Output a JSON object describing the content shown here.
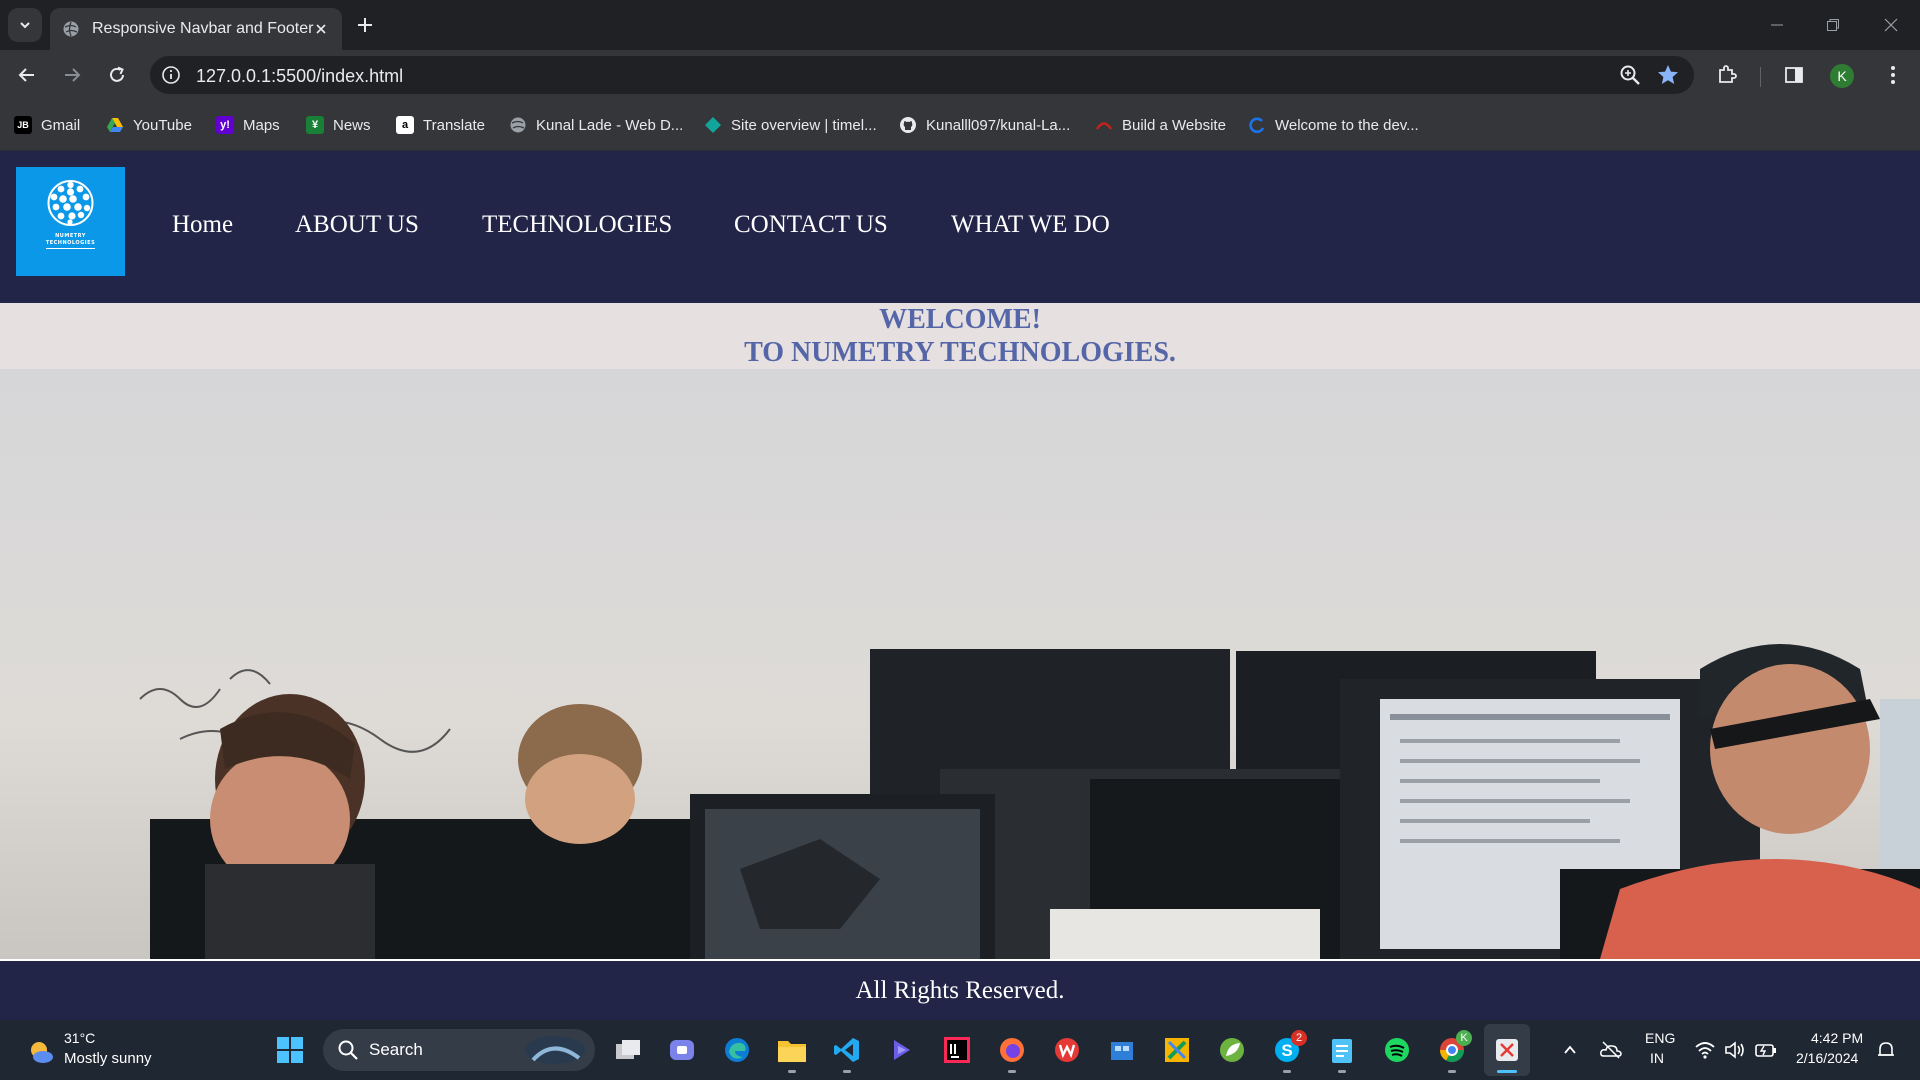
{
  "browser": {
    "tab": {
      "title": "Responsive Navbar and Footer"
    },
    "address_bar": {
      "url": "127.0.0.1:5500/index.html"
    },
    "profile_initial": "K",
    "bookmarks": [
      {
        "label": "Gmail",
        "icon": "jetbrains-icon"
      },
      {
        "label": "YouTube",
        "icon": "google-drive-icon"
      },
      {
        "label": "Maps",
        "icon": "yahoo-icon"
      },
      {
        "label": "News",
        "icon": "news-icon"
      },
      {
        "label": "Translate",
        "icon": "amazon-icon"
      },
      {
        "label": "Kunal Lade - Web D...",
        "icon": "globe-icon"
      },
      {
        "label": "Site overview | timel...",
        "icon": "diamond-icon"
      },
      {
        "label": "Kunalll097/kunal-La...",
        "icon": "github-icon"
      },
      {
        "label": "Build a Website",
        "icon": "build-icon"
      },
      {
        "label": "Welcome to the dev...",
        "icon": "dev-icon"
      }
    ]
  },
  "site": {
    "logo": {
      "line1": "NUMETRY",
      "line2": "TECHNOLOGIES"
    },
    "nav": [
      "Home",
      "ABOUT US",
      "TECHNOLOGIES",
      "CONTACT US",
      "WHAT WE DO"
    ],
    "welcome": {
      "line1": "WELCOME!",
      "line2": "TO NUMETRY TECHNOLOGIES."
    },
    "footer": "All Rights Reserved.",
    "colors": {
      "navbar": "#222448",
      "logo_bg": "#0c98e8",
      "welcome_text": "#5566a8",
      "welcome_bg": "#e6e0e0"
    }
  },
  "taskbar": {
    "weather": {
      "temp": "31°C",
      "condition": "Mostly sunny"
    },
    "search_label": "Search",
    "apps": [
      "windows-start-icon",
      "task-view-icon",
      "teams-icon",
      "edge-icon",
      "file-explorer-icon",
      "vscode-icon",
      "copilot-icon",
      "intellij-icon",
      "firefox-icon",
      "wps-icon",
      "store-icon",
      "snipping-icon",
      "spring-icon",
      "skype-icon",
      "notepad-icon",
      "spotify-icon",
      "chrome-icon",
      "snip-sketch-icon"
    ],
    "skype_badge": "2",
    "language": {
      "line1": "ENG",
      "line2": "IN"
    },
    "clock": {
      "time": "4:42 PM",
      "date": "2/16/2024"
    }
  }
}
